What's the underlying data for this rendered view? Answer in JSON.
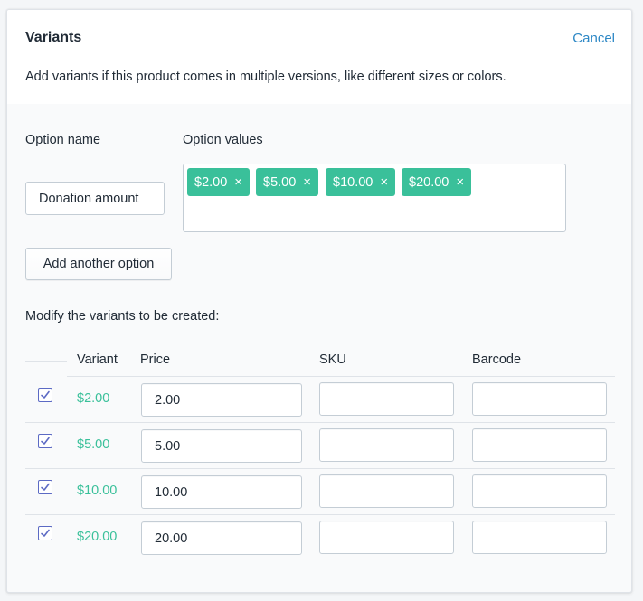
{
  "header": {
    "title": "Variants",
    "cancel_label": "Cancel",
    "description": "Add variants if this product comes in multiple versions, like different sizes or colors."
  },
  "options": {
    "name_label": "Option name",
    "values_label": "Option values",
    "name_value": "Donation amount",
    "values": [
      "$2.00",
      "$5.00",
      "$10.00",
      "$20.00"
    ],
    "add_button": "Add another option"
  },
  "variants": {
    "intro": "Modify the variants to be created:",
    "columns": [
      "Variant",
      "Price",
      "SKU",
      "Barcode"
    ],
    "rows": [
      {
        "checked": true,
        "variant": "$2.00",
        "price": "2.00",
        "sku": "",
        "barcode": ""
      },
      {
        "checked": true,
        "variant": "$5.00",
        "price": "5.00",
        "sku": "",
        "barcode": ""
      },
      {
        "checked": true,
        "variant": "$10.00",
        "price": "10.00",
        "sku": "",
        "barcode": ""
      },
      {
        "checked": true,
        "variant": "$20.00",
        "price": "20.00",
        "sku": "",
        "barcode": ""
      }
    ]
  },
  "colors": {
    "accent": "#3ac09a",
    "link": "#2c87c5",
    "checkbox": "#5c6ac4"
  },
  "icons": {
    "tag_remove": "close-icon",
    "checkbox": "checkmark-icon"
  }
}
